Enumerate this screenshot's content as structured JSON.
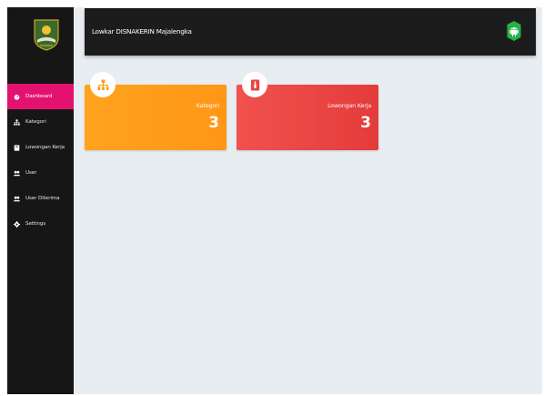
{
  "header": {
    "title": "Lowkar DISNAKERIN Majalengka"
  },
  "icons": {
    "logo": "regency-emblem-icon",
    "topbar": "android-icon"
  },
  "sidebar": {
    "items": [
      {
        "label": "Dashboard",
        "icon": "dashboard-icon",
        "active": true
      },
      {
        "label": "Kategori",
        "icon": "sitemap-icon",
        "active": false
      },
      {
        "label": "Lowongan Kerja",
        "icon": "briefcase-icon",
        "active": false
      },
      {
        "label": "User",
        "icon": "users-icon",
        "active": false
      },
      {
        "label": "User Diterima",
        "icon": "users-icon",
        "active": false
      },
      {
        "label": "Settings",
        "icon": "gear-icon",
        "active": false
      }
    ]
  },
  "cards": [
    {
      "label": "Kategori",
      "value": "3",
      "icon": "sitemap-icon",
      "color": "#ff9c1a"
    },
    {
      "label": "Lowongan Kerja",
      "value": "3",
      "icon": "tie-icon",
      "color": "#e84545"
    }
  ],
  "colors": {
    "sidebar": "#161616",
    "active_item": "#e4126e",
    "topbar": "#1c1c1c",
    "background": "#e8edf1",
    "android": "#27b24a"
  }
}
